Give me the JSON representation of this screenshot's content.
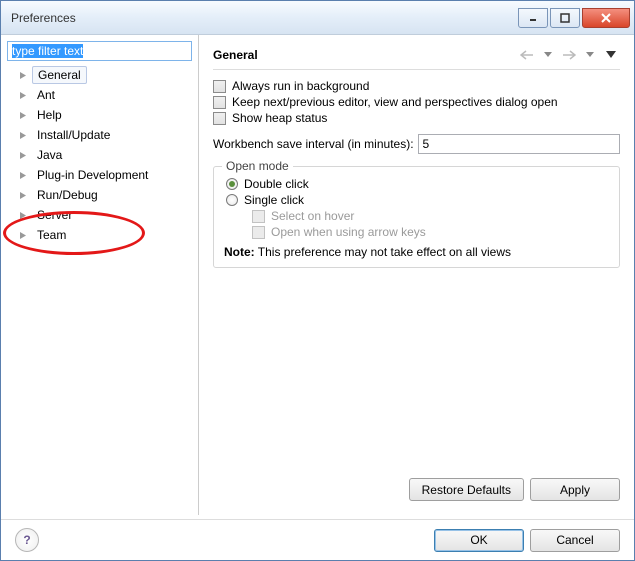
{
  "window": {
    "title": "Preferences"
  },
  "filter": {
    "placeholder": "type filter text",
    "value": "type filter text"
  },
  "tree": {
    "items": [
      {
        "label": "General",
        "selected": true
      },
      {
        "label": "Ant"
      },
      {
        "label": "Help"
      },
      {
        "label": "Install/Update"
      },
      {
        "label": "Java"
      },
      {
        "label": "Plug-in Development"
      },
      {
        "label": "Run/Debug"
      },
      {
        "label": "Server"
      },
      {
        "label": "Team"
      }
    ]
  },
  "page": {
    "title": "General",
    "checks": {
      "runbg": "Always run in background",
      "keepnext": "Keep next/previous editor, view and perspectives dialog open",
      "showheap": "Show heap status"
    },
    "saveIntervalLabel": "Workbench save interval (in minutes):",
    "saveIntervalValue": "5",
    "openmode": {
      "legend": "Open mode",
      "double": "Double click",
      "single": "Single click",
      "hover": "Select on hover",
      "arrow": "Open when using arrow keys"
    },
    "noteLabel": "Note:",
    "noteText": " This preference may not take effect on all views",
    "restore": "Restore Defaults",
    "apply": "Apply",
    "ok": "OK",
    "cancel": "Cancel"
  }
}
